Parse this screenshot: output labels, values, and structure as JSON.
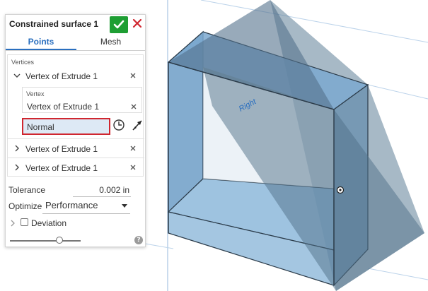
{
  "panel": {
    "title": "Constrained surface 1",
    "tabs": [
      {
        "label": "Points",
        "active": true
      },
      {
        "label": "Mesh",
        "active": false
      }
    ],
    "vertices_label": "Vertices",
    "vertex_items": [
      {
        "label": "Vertex of Extrude 1",
        "expanded": true
      },
      {
        "label": "Vertex of Extrude 1",
        "expanded": false
      },
      {
        "label": "Vertex of Extrude 1",
        "expanded": false
      }
    ],
    "vertex_sub_label": "Vertex",
    "vertex_sub_value": "Vertex of Extrude 1",
    "normal_value": "Normal",
    "tolerance_label": "Tolerance",
    "tolerance_value": "0.002 in",
    "optimize_label": "Optimize",
    "optimize_value": "Performance",
    "deviation_label": "Deviation",
    "deviation_checked": false,
    "slider_value": 0.7
  },
  "viewport": {
    "plane_label": "Right"
  },
  "colors": {
    "accent": "#2a6fbf",
    "ok": "#1e9e33",
    "close": "#d0262f",
    "highlight_border": "#d0262f",
    "field_fill": "#dde9f5"
  },
  "icons": [
    "check-icon",
    "close-icon",
    "chevron-down-icon",
    "chevron-right-icon",
    "clock-icon",
    "flip-arrow-icon",
    "caret-down-icon",
    "help-icon"
  ]
}
